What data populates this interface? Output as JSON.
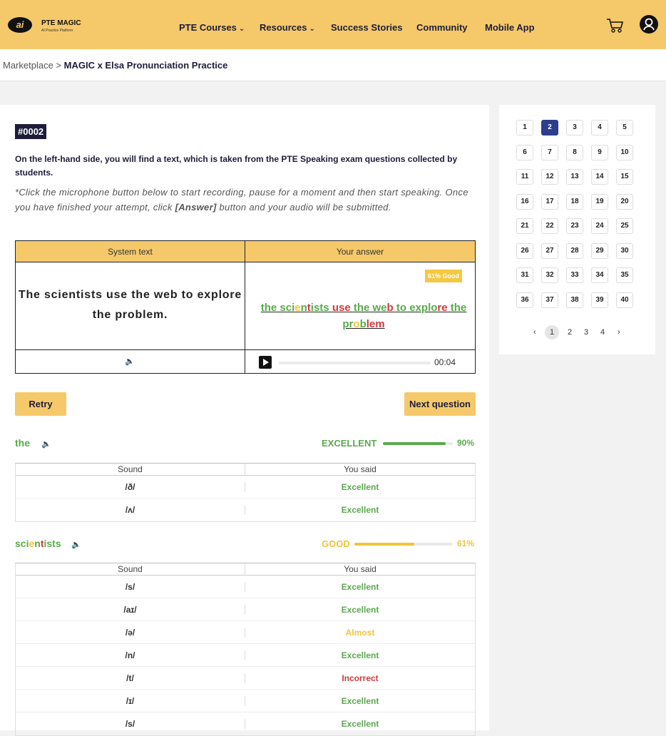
{
  "brand": {
    "name": "PTE MAGIC",
    "tagline": "AI Practice Platform",
    "logo_text": "ai"
  },
  "nav": {
    "courses": "PTE Courses",
    "resources": "Resources",
    "success": "Success Stories",
    "community": "Community",
    "mobile": "Mobile App"
  },
  "breadcrumb": {
    "root": "Marketplace",
    "sep": " > ",
    "current": "MAGIC x Elsa Pronunciation Practice"
  },
  "question": {
    "id": "#0002",
    "intro": "On the left-hand side, you will find a text, which is taken from the PTE Speaking exam questions collected by students.",
    "instr_before": "*Click the microphone button below to start recording, pause for a moment and then start speaking. Once you have finished your attempt, click ",
    "instr_answer": "[Answer]",
    "instr_after": " button and your audio will be submitted."
  },
  "compare": {
    "system_header": "System text",
    "answer_header": "Your answer",
    "system_text": "The scientists use the web to explore the problem.",
    "badge": "61% Good",
    "time": "00:04",
    "answer_tokens": [
      {
        "t": "the",
        "c": "g"
      },
      {
        "t": " ",
        "c": ""
      },
      {
        "t": "sci",
        "c": "g"
      },
      {
        "t": "e",
        "c": "y"
      },
      {
        "t": "n",
        "c": "g"
      },
      {
        "t": "t",
        "c": "r"
      },
      {
        "t": "ists",
        "c": "g"
      },
      {
        "t": " ",
        "c": ""
      },
      {
        "t": "use",
        "c": "r"
      },
      {
        "t": " ",
        "c": ""
      },
      {
        "t": "the",
        "c": "g"
      },
      {
        "t": " ",
        "c": ""
      },
      {
        "t": "we",
        "c": "g"
      },
      {
        "t": "b",
        "c": "r"
      },
      {
        "t": " ",
        "c": ""
      },
      {
        "t": "to",
        "c": "g"
      },
      {
        "t": " ",
        "c": ""
      },
      {
        "t": "explo",
        "c": "g"
      },
      {
        "t": "re",
        "c": "r"
      },
      {
        "t": " ",
        "c": ""
      },
      {
        "t": "the",
        "c": "g"
      },
      {
        "t": " ",
        "c": ""
      },
      {
        "t": "pr",
        "c": "g"
      },
      {
        "t": "o",
        "c": "y"
      },
      {
        "t": "b",
        "c": "g"
      },
      {
        "t": "lem",
        "c": "r"
      }
    ]
  },
  "buttons": {
    "retry": "Retry",
    "next": "Next question"
  },
  "words": [
    {
      "word_parts": [
        {
          "t": "the",
          "c": "g"
        }
      ],
      "rating": "EXCELLENT",
      "percent_label": "90%",
      "percent": 90,
      "color": "#5aa94d",
      "sound_header": "Sound",
      "said_header": "You said",
      "rows": [
        {
          "sound": "/ð/",
          "said": "Excellent",
          "c": "g"
        },
        {
          "sound": "/ʌ/",
          "said": "Excellent",
          "c": "g"
        }
      ]
    },
    {
      "word_parts": [
        {
          "t": "sci",
          "c": "g"
        },
        {
          "t": "e",
          "c": "y"
        },
        {
          "t": "n",
          "c": "g"
        },
        {
          "t": "t",
          "c": "r"
        },
        {
          "t": "ists",
          "c": "g"
        }
      ],
      "rating": "GOOD",
      "percent_label": "61%",
      "percent": 61,
      "color": "#f1c43a",
      "sound_header": "Sound",
      "said_header": "You said",
      "rows": [
        {
          "sound": "/s/",
          "said": "Excellent",
          "c": "g"
        },
        {
          "sound": "/aɪ/",
          "said": "Excellent",
          "c": "g"
        },
        {
          "sound": "/ə/",
          "said": "Almost",
          "c": "y"
        },
        {
          "sound": "/n/",
          "said": "Excellent",
          "c": "g"
        },
        {
          "sound": "/t/",
          "said": "Incorrect",
          "c": "r"
        },
        {
          "sound": "/ɪ/",
          "said": "Excellent",
          "c": "g"
        },
        {
          "sound": "/s/",
          "said": "Excellent",
          "c": "g"
        }
      ]
    }
  ],
  "sidebar": {
    "numbers": [
      "1",
      "2",
      "3",
      "4",
      "5",
      "6",
      "7",
      "8",
      "9",
      "10",
      "11",
      "12",
      "13",
      "14",
      "15",
      "16",
      "17",
      "18",
      "19",
      "20",
      "21",
      "22",
      "23",
      "24",
      "25",
      "26",
      "27",
      "28",
      "29",
      "30",
      "31",
      "32",
      "33",
      "34",
      "35",
      "36",
      "37",
      "38",
      "39",
      "40"
    ],
    "active": "2",
    "pages": [
      "1",
      "2",
      "3",
      "4"
    ],
    "active_page": "1",
    "prev": "‹",
    "next": "›"
  }
}
